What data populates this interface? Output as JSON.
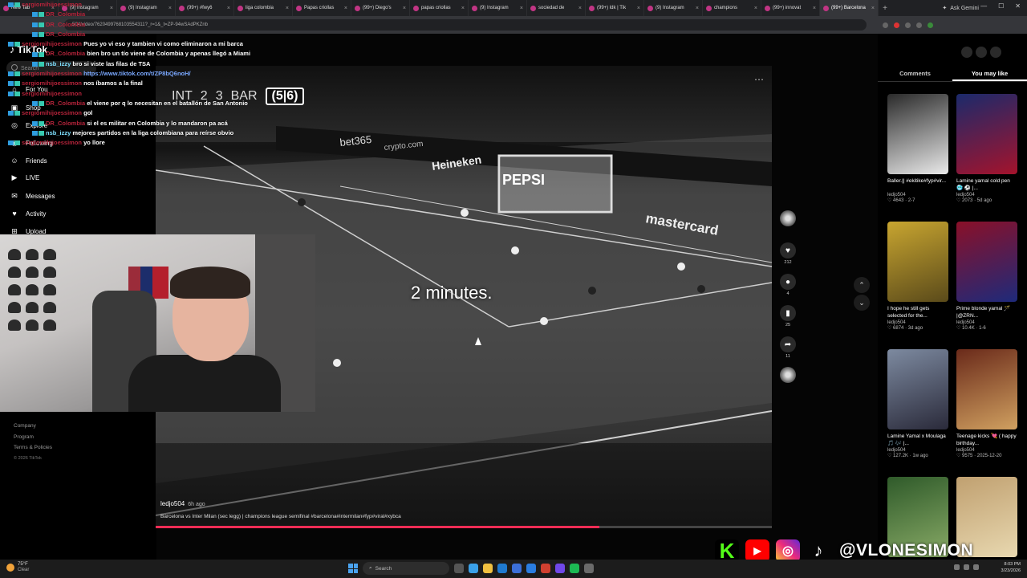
{
  "browser": {
    "tabs": [
      {
        "label": "New Tab",
        "active": false
      },
      {
        "label": "(9) Instagram",
        "active": false
      },
      {
        "label": "(9) Instagram",
        "active": false
      },
      {
        "label": "(99+) #fwy6",
        "active": false
      },
      {
        "label": "liga colombia",
        "active": false
      },
      {
        "label": "Papas criollas",
        "active": false
      },
      {
        "label": "(99+) Diego's",
        "active": false
      },
      {
        "label": "papas criollas",
        "active": false
      },
      {
        "label": "(9) Instagram",
        "active": false
      },
      {
        "label": "sociedad de",
        "active": false
      },
      {
        "label": "(99+) ldk | Tik",
        "active": false
      },
      {
        "label": "(9) Instagram",
        "active": false
      },
      {
        "label": "champions",
        "active": false
      },
      {
        "label": "(99+) innovat",
        "active": false
      },
      {
        "label": "(99+) Barcelona",
        "active": true
      }
    ],
    "ask_gemini": "Ask Gemini",
    "url": "504/video/7620499768103554311?_r=1&_t=ZP-94wSAdPKZnb"
  },
  "tiktok": {
    "logo": "TikTok",
    "search_placeholder": "Search",
    "nav": [
      {
        "label": "For You"
      },
      {
        "label": "Shop"
      },
      {
        "label": "Explore"
      },
      {
        "label": "Following"
      },
      {
        "label": "Friends"
      },
      {
        "label": "LIVE"
      },
      {
        "label": "Messages"
      },
      {
        "label": "Activity"
      },
      {
        "label": "Upload"
      }
    ],
    "footer": {
      "company": "Company",
      "program": "Program",
      "terms": "Terms & Policies",
      "copyright": "© 2026 TikTok"
    }
  },
  "chat": {
    "lines": [
      {
        "user": "sergiomihijoessimon",
        "text": ""
      },
      {
        "user": "DR_Colombia",
        "text": ""
      },
      {
        "user": "DR_Colombia",
        "text": ""
      },
      {
        "user": "DR_Colombia",
        "text": ""
      },
      {
        "user": "sergiomihijoessimon",
        "text": "Pues yo vi eso y tambien vi como eliminaron a mi barca"
      },
      {
        "user": "DR_Colombia",
        "text": "bien bro un tío viene de Colombia y apenas llegó a Miami"
      },
      {
        "user": "nsb_izzy",
        "text": "bro si viste las filas de TSA"
      },
      {
        "user": "sergiomihijoessimon",
        "text": "https://www.tiktok.com/t/ZP8bQ6noH/"
      },
      {
        "user": "sergiomihijoessimon",
        "text": "nos íbamos a la final"
      },
      {
        "user": "sergiomihijoessimon",
        "text": ""
      },
      {
        "user": "DR_Colombia",
        "text": "el viene por q lo necesitan en el batallón de San Antonio"
      },
      {
        "user": "sergiomihijoessimon",
        "text": "gol"
      },
      {
        "user": "DR_Colombia",
        "text": "si el es militar en Colombia y lo mandaron pa acá"
      },
      {
        "user": "nsb_izzy",
        "text": "mejores partidos en la liga colombiana para reírse obvio"
      },
      {
        "user": "sergiomihijoessimon",
        "text": "yo llore"
      }
    ]
  },
  "video": {
    "scoreboard": {
      "left_team": "INT",
      "left_score": "2",
      "right_score": "3",
      "right_team": "BAR",
      "aggregate": "(5|6)"
    },
    "caption_overlay": "2 minutes.",
    "author": "ledjo504",
    "posted": "6h ago",
    "description": "Barcelona vs Inter Milan (sec legg) | champions league semifinal #barcelona#intermilan#fyp#viral#xybca",
    "progress": 0.72,
    "actions": {
      "likes": "212",
      "comments": "4",
      "saves": "25",
      "shares": "11"
    }
  },
  "right_panel": {
    "tabs": [
      {
        "label": "Comments"
      },
      {
        "label": "You may like"
      }
    ],
    "cards": [
      {
        "title": "Baller.|| #ekitike#fyp#vir...",
        "author": "ledjo504",
        "likes": "4643",
        "date": "2-7",
        "thumb": "#2a2a2a",
        "thumb2": "#eaeaea"
      },
      {
        "title": "Lamine yamal cold pen 🥶 ⚽ |...",
        "author": "ledjo504",
        "likes": "2073",
        "date": "5d ago",
        "thumb": "#1b2a6b",
        "thumb2": "#a4132c"
      },
      {
        "title": "I hope he still gets selected for the...",
        "author": "ledjo504",
        "likes": "6874",
        "date": "3d ago",
        "thumb": "#c8a530",
        "thumb2": "#5a4a1a"
      },
      {
        "title": "Prime blonde yamal 🪄 |@ZRN...",
        "author": "ledjo504",
        "likes": "10.4K",
        "date": "1-6",
        "thumb": "#8a1028",
        "thumb2": "#1e2a7a"
      },
      {
        "title": "Lamine Yamal x Moulaga 🎵 🎶 |...",
        "author": "ledjo504",
        "likes": "127.2K",
        "date": "1w ago",
        "thumb": "#7d8aa0",
        "thumb2": "#2a2a3a"
      },
      {
        "title": "Teenage kicks 💘 ( happy birthday...",
        "author": "ledjo504",
        "likes": "9575",
        "date": "2025-12-20",
        "thumb": "#6a2a1a",
        "thumb2": "#d0a060"
      },
      {
        "title": "",
        "author": "",
        "likes": "",
        "date": "",
        "thumb": "#2f5a2a",
        "thumb2": "#88aa66"
      },
      {
        "title": "",
        "author": "",
        "likes": "",
        "date": "",
        "thumb": "#c0a070",
        "thumb2": "#e8d8b0"
      }
    ]
  },
  "taskbar": {
    "weather_temp": "75°F",
    "weather_desc": "Clear",
    "search_label": "Search",
    "time": "8:03 PM",
    "date": "3/23/2026"
  },
  "overlay": {
    "handle": "@VLONESIMON",
    "icons": [
      "kick-icon",
      "youtube-icon",
      "instagram-icon",
      "tiktok-icon"
    ]
  }
}
